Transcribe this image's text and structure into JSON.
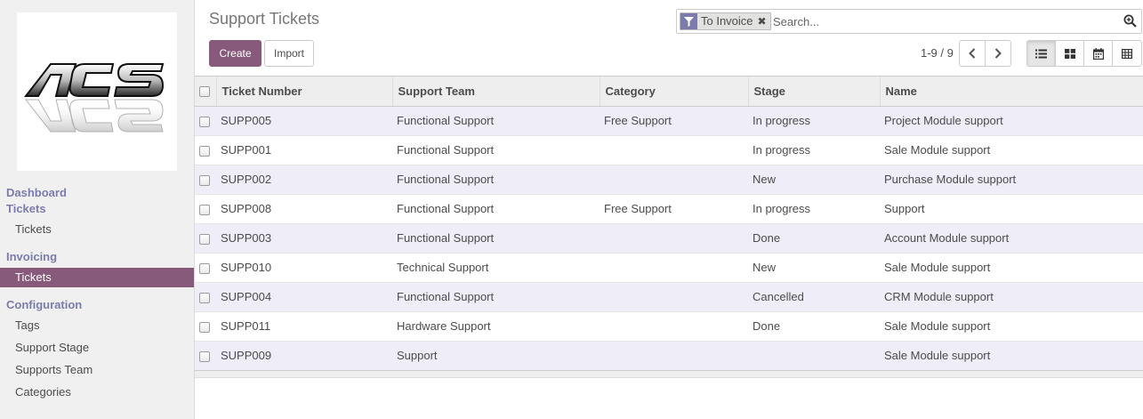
{
  "sidebar": {
    "logo_text": "ACS",
    "sections": [
      {
        "title": "Dashboard"
      },
      {
        "title": "Tickets",
        "items": [
          {
            "label": "Tickets"
          }
        ]
      },
      {
        "title": "Invoicing",
        "items": [
          {
            "label": "Tickets",
            "active": true
          }
        ]
      },
      {
        "title": "Configuration",
        "items": [
          {
            "label": "Tags"
          },
          {
            "label": "Support Stage"
          },
          {
            "label": "Supports Team"
          },
          {
            "label": "Categories"
          }
        ]
      }
    ]
  },
  "control_panel": {
    "breadcrumb": "Support Tickets",
    "create_label": "Create",
    "import_label": "Import",
    "search": {
      "facet_label": "To Invoice",
      "facet_icon": "filter-icon",
      "placeholder": "Search..."
    },
    "pager": {
      "value": "1-9 / 9"
    },
    "views": [
      {
        "name": "list-view-icon",
        "active": true
      },
      {
        "name": "kanban-view-icon",
        "active": false
      },
      {
        "name": "calendar-view-icon",
        "active": false
      },
      {
        "name": "pivot-view-icon",
        "active": false
      }
    ]
  },
  "table": {
    "columns": [
      "Ticket Number",
      "Support Team",
      "Category",
      "Stage",
      "Name"
    ],
    "rows": [
      [
        "SUPP005",
        "Functional Support",
        "Free Support",
        "In progress",
        "Project Module support"
      ],
      [
        "SUPP001",
        "Functional Support",
        "",
        "In progress",
        "Sale Module support"
      ],
      [
        "SUPP002",
        "Functional Support",
        "",
        "New",
        "Purchase Module support"
      ],
      [
        "SUPP008",
        "Functional Support",
        "Free Support",
        "In progress",
        "Support"
      ],
      [
        "SUPP003",
        "Functional Support",
        "",
        "Done",
        "Account Module support"
      ],
      [
        "SUPP010",
        "Technical Support",
        "",
        "New",
        "Sale Module support"
      ],
      [
        "SUPP004",
        "Functional Support",
        "",
        "Cancelled",
        "CRM Module support"
      ],
      [
        "SUPP011",
        "Hardware Support",
        "",
        "Done",
        "Sale Module support"
      ],
      [
        "SUPP009",
        "Support",
        "",
        "",
        "Sale Module support"
      ]
    ]
  },
  "colors": {
    "brand": "#875a7b",
    "section_title": "#7c7bad",
    "row_stripe": "#efedf7"
  }
}
